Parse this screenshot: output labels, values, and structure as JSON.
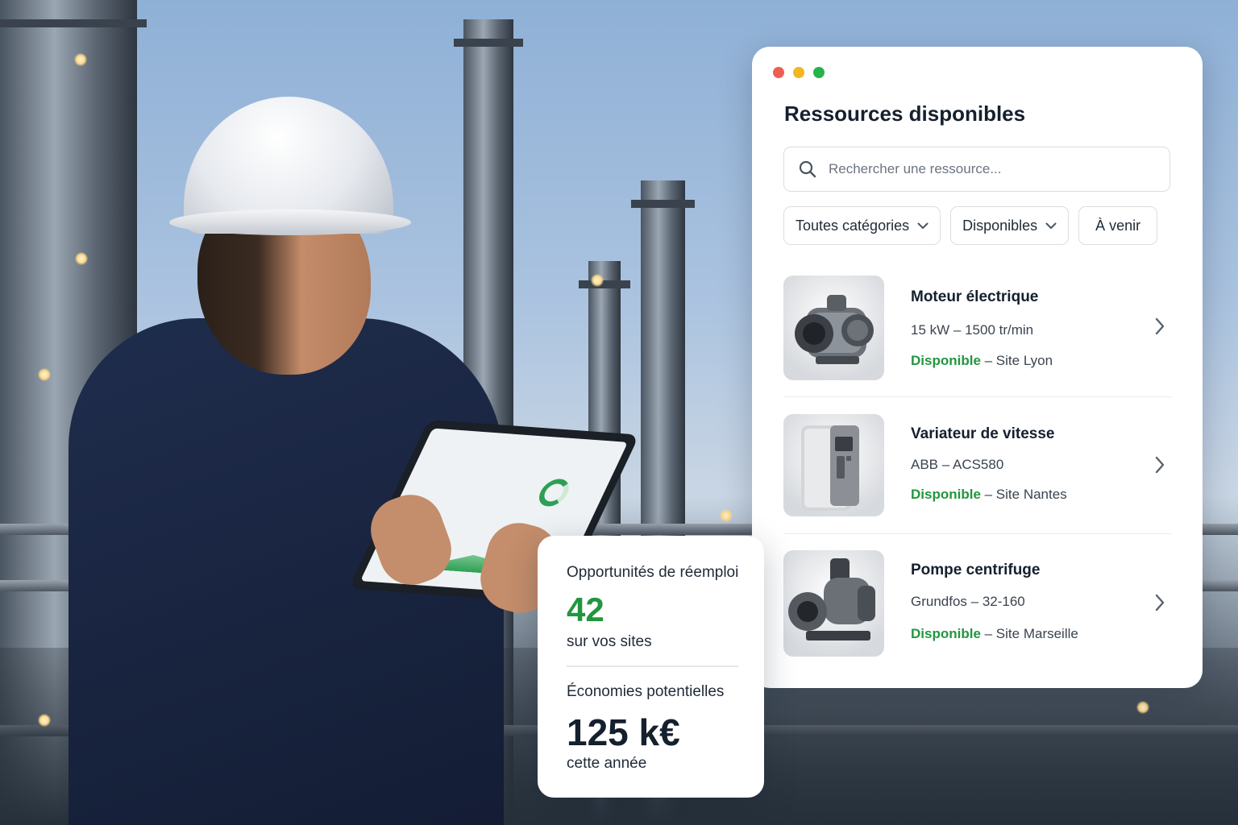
{
  "window_dots": [
    "#ee5e55",
    "#f2b623",
    "#27b24a"
  ],
  "panel": {
    "title": "Ressources disponibles",
    "search": {
      "placeholder": "Rechercher une ressource...",
      "icon": "search-icon"
    },
    "filters": [
      {
        "label": "Toutes catégories",
        "icon": "chevron-down-icon"
      },
      {
        "label": "Disponibles",
        "icon": "chevron-down-icon"
      },
      {
        "label": "À venir"
      }
    ],
    "items": [
      {
        "name": "Moteur électrique",
        "spec": "15 kW – 1500 tr/min",
        "status": "Disponible",
        "location": " – Site Lyon",
        "image": "electric-motor"
      },
      {
        "name": "Variateur de vitesse",
        "spec": "ABB – ACS580",
        "status": "Disponible",
        "location": " – Site Nantes",
        "image": "variable-speed-drive"
      },
      {
        "name": "Pompe centrifuge",
        "spec": "Grundfos – 32-160",
        "status": "Disponible",
        "location": " – Site Marseille",
        "image": "centrifugal-pump"
      }
    ],
    "status_color": "#22963f"
  },
  "stats": {
    "reuse_label": "Opportunités de réemploi",
    "reuse_value": "42",
    "reuse_sub": "sur vos sites",
    "savings_label": "Économies potentielles",
    "savings_value": "125 k€",
    "savings_sub": "cette année",
    "accent": "#22963f"
  }
}
